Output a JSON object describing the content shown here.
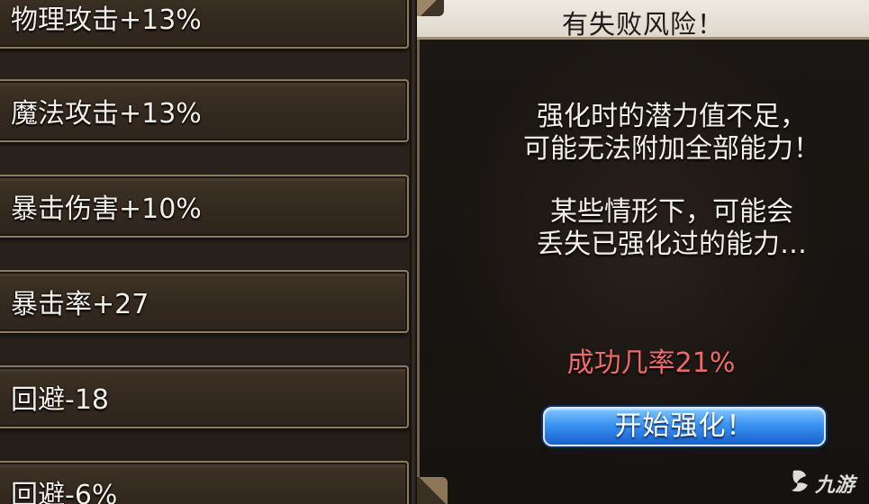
{
  "stats": [
    {
      "label": "物理攻击+13%"
    },
    {
      "label": "魔法攻击+13%"
    },
    {
      "label": "暴击伤害+10%"
    },
    {
      "label": "暴击率+27"
    },
    {
      "label": "回避-18"
    },
    {
      "label": "回避-6%"
    }
  ],
  "dialog": {
    "title": "有失败风险！",
    "message_lines": [
      "强化时的潜力值不足，",
      "可能无法附加全部能力！",
      "某些情形下，可能会",
      "丢失已强化过的能力…"
    ],
    "success_rate": "成功几率21%",
    "start_button": "开始强化！"
  },
  "watermark": {
    "logo_icon": "jiuyou-logo-icon",
    "text": "九游"
  },
  "colors": {
    "success_rate": "#ee6a6a",
    "button_blue": "#3a93f0",
    "header_bg": "#eeeae2"
  }
}
